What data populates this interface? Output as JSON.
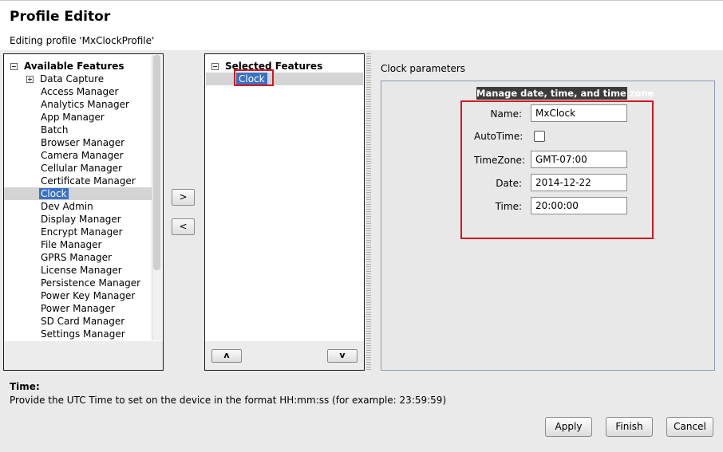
{
  "header": {
    "title": "Profile Editor",
    "subtitle": "Editing profile 'MxClockProfile'"
  },
  "available": {
    "header": "Available Features",
    "expandable_item": "Data Capture",
    "items": [
      "Access Manager",
      "Analytics Manager",
      "App Manager",
      "Batch",
      "Browser Manager",
      "Camera Manager",
      "Cellular Manager",
      "Certificate Manager",
      "Clock",
      "Dev Admin",
      "Display Manager",
      "Encrypt Manager",
      "File Manager",
      "GPRS Manager",
      "License Manager",
      "Persistence Manager",
      "Power Key Manager",
      "Power Manager",
      "SD Card Manager",
      "Settings Manager"
    ],
    "selected_index": 8
  },
  "transfer": {
    "add_label": ">",
    "remove_label": "<"
  },
  "selected": {
    "header": "Selected Features",
    "items": [
      "Clock"
    ],
    "up_label": "ʌ",
    "down_label": "v"
  },
  "params": {
    "label": "Clock parameters",
    "group_title": "Manage date, time, and time zone",
    "fields": {
      "name": {
        "label": "Name:",
        "value": "MxClock"
      },
      "autotime": {
        "label": "AutoTime:",
        "checked": false
      },
      "timezone": {
        "label": "TimeZone:",
        "value": "GMT-07:00"
      },
      "date": {
        "label": "Date:",
        "value": "2014-12-22"
      },
      "time": {
        "label": "Time:",
        "value": "20:00:00"
      }
    }
  },
  "help": {
    "title": "Time:",
    "text": "Provide the UTC Time to set on the device in the format HH:mm:ss (for example: 23:59:59)"
  },
  "buttons": {
    "apply": "Apply",
    "finish": "Finish",
    "cancel": "Cancel"
  },
  "colors": {
    "selection": "#3a71c2",
    "highlight_box": "#d01820"
  }
}
